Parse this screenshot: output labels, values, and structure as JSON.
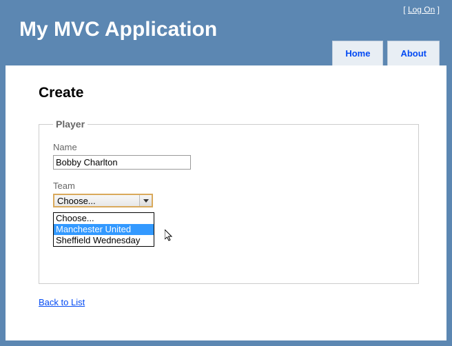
{
  "header": {
    "logon_prefix": "[ ",
    "logon_label": "Log On",
    "logon_suffix": " ]",
    "title": "My MVC Application",
    "nav": {
      "home_label": "Home",
      "about_label": "About"
    }
  },
  "page": {
    "heading": "Create",
    "fieldset_legend": "Player",
    "name": {
      "label": "Name",
      "value": "Bobby Charlton"
    },
    "team": {
      "label": "Team",
      "selected": "Choose...",
      "options": [
        "Choose...",
        "Manchester United",
        "Sheffield Wednesday"
      ],
      "highlighted_index": 1
    },
    "back_label": "Back to List"
  }
}
